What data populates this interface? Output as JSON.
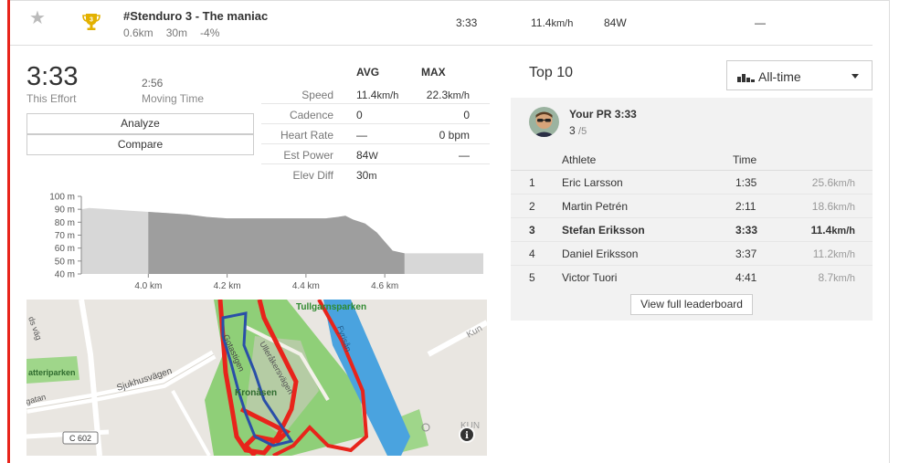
{
  "segment": {
    "title": "#Stenduro 3 - The maniac",
    "distance": "0.6km",
    "elevation": "30m",
    "grade": "-4%",
    "time": "3:33",
    "speed_value": "11.4",
    "speed_unit": "km/h",
    "power": "84W",
    "heart_rate": "—",
    "trophy_rank": "3"
  },
  "effort": {
    "time": "3:33",
    "time_label": "This Effort",
    "moving_time": "2:56",
    "moving_label": "Moving Time",
    "analyze_label": "Analyze",
    "compare_label": "Compare"
  },
  "stats": {
    "avg_header": "AVG",
    "max_header": "MAX",
    "rows": [
      {
        "label": "Speed",
        "avg": "11.4",
        "avg_unit": "km/h",
        "max": "22.3",
        "max_unit": "km/h"
      },
      {
        "label": "Cadence",
        "avg": "0",
        "avg_unit": "",
        "max": "0",
        "max_unit": ""
      },
      {
        "label": "Heart Rate",
        "avg": "—",
        "avg_unit": "",
        "max": "0 ",
        "max_unit": "bpm"
      },
      {
        "label": "Est Power",
        "avg": "84",
        "avg_unit": "W",
        "max": "—",
        "max_unit": ""
      },
      {
        "label": "Elev Diff",
        "avg": "30",
        "avg_unit": "m",
        "max": "",
        "max_unit": ""
      }
    ]
  },
  "chart_data": {
    "type": "area",
    "title": "",
    "xlabel": "",
    "ylabel": "",
    "y_ticks": [
      "100 m",
      "90 m",
      "80 m",
      "70 m",
      "60 m",
      "50 m",
      "40 m"
    ],
    "x_ticks": [
      "4.0 km",
      "4.2 km",
      "4.4 km",
      "4.6 km"
    ],
    "ylim": [
      40,
      100
    ],
    "xlim": [
      3.83,
      4.85
    ],
    "x_tick_values": [
      4.0,
      4.2,
      4.4,
      4.6
    ],
    "highlight_range": [
      4.0,
      4.65
    ],
    "x": [
      3.83,
      3.85,
      3.9,
      3.95,
      4.0,
      4.05,
      4.1,
      4.15,
      4.2,
      4.25,
      4.3,
      4.35,
      4.4,
      4.45,
      4.48,
      4.5,
      4.52,
      4.55,
      4.58,
      4.6,
      4.62,
      4.65,
      4.7,
      4.75,
      4.8,
      4.85
    ],
    "y": [
      90,
      91,
      90,
      89,
      88,
      87,
      86,
      84,
      83,
      83,
      83,
      83,
      83,
      83,
      84,
      85,
      82,
      79,
      72,
      65,
      58,
      56,
      56,
      56,
      56,
      56
    ]
  },
  "map": {
    "labels": {
      "park1": "Tullgarnsparken",
      "park2": "atteriparken",
      "road1": "Sjukhusvägen",
      "road2": "Ulleråkersvägen",
      "road3": "gatan",
      "road4": "Fyrisån",
      "area1": "Kronåsen",
      "road5": "Gotastigen",
      "road_sign": "C 602",
      "edge1": "Kun",
      "edge2": "KUN",
      "edge3": "ds väg"
    },
    "info_icon": "info-icon"
  },
  "leaderboard": {
    "title": "Top 10",
    "filter": "All-time",
    "pr_label": "Your PR 3:33",
    "pr_rank": "3",
    "pr_of": "/5",
    "col_athlete": "Athlete",
    "col_time": "Time",
    "rows": [
      {
        "rank": "1",
        "name": "Eric Larsson",
        "time": "1:35",
        "speed": "25.6",
        "unit": "km/h"
      },
      {
        "rank": "2",
        "name": "Martin Petrén",
        "time": "2:11",
        "speed": "18.6",
        "unit": "km/h"
      },
      {
        "rank": "3",
        "name": "Stefan Eriksson",
        "time": "3:33",
        "speed": "11.4",
        "unit": "km/h"
      },
      {
        "rank": "4",
        "name": "Daniel Eriksson",
        "time": "3:37",
        "speed": "11.2",
        "unit": "km/h"
      },
      {
        "rank": "5",
        "name": "Victor Tuori",
        "time": "4:41",
        "speed": "8.7",
        "unit": "km/h"
      }
    ],
    "view_full": "View full leaderboard"
  },
  "colors": {
    "accent": "#e8241b",
    "trophy": "#e3b100",
    "route_blue": "#2a4fa8",
    "park_green": "#7fc86a",
    "water": "#4aa3df"
  }
}
